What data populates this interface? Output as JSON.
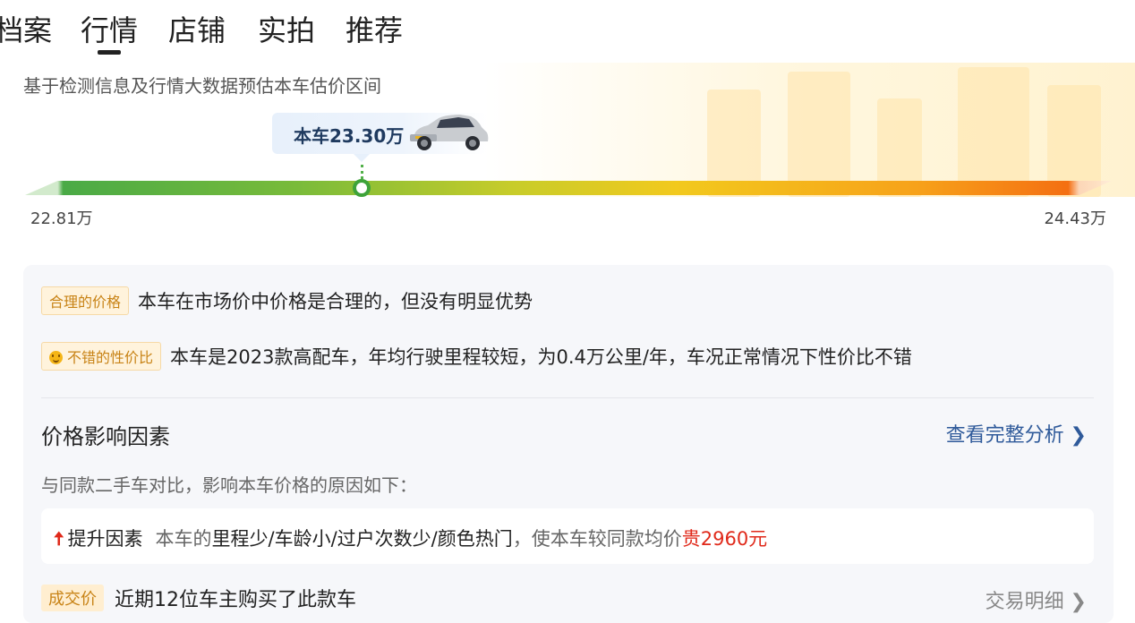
{
  "tabs": [
    {
      "label": "档案"
    },
    {
      "label": "行情"
    },
    {
      "label": "店铺"
    },
    {
      "label": "实拍"
    },
    {
      "label": "推荐"
    }
  ],
  "active_tab": "行情",
  "subtitle": "基于检测信息及行情大数据预估本车估价区间",
  "price_range": {
    "current_label": "本车23.30万",
    "current_value_wan": 23.3,
    "min_label": "22.81万",
    "max_label": "24.43万",
    "min_wan": 22.81,
    "max_wan": 24.43,
    "gradient_colors": [
      "#4aaa46",
      "#c8cc2a",
      "#f2c91d",
      "#f46f12"
    ]
  },
  "assessments": [
    {
      "badge": "合理的价格",
      "text": "本车在市场价中价格是合理的，但没有明显优势"
    },
    {
      "badge": "不错的性价比",
      "icon": "smile-icon",
      "text": "本车是2023款高配车，年均行驶里程较短，为0.4万公里/年，车况正常情况下性价比不错"
    }
  ],
  "factors": {
    "title": "价格影响因素",
    "link": "查看完整分析 ❯",
    "desc": "与同款二手车对比，影响本车价格的原因如下：",
    "items": [
      {
        "icon": "arrow-up-icon",
        "label": "提升因素",
        "prefix": "本车的",
        "emphasis": "里程少/车龄小/过户次数少/颜色热门",
        "middle": "，使本车较同款均价",
        "price": "贵2960元"
      }
    ]
  },
  "deal": {
    "badge": "成交价",
    "text": "近期12位车主购买了此款车",
    "link": "交易明细 ❯"
  },
  "colors": {
    "accent_red": "#e0291a",
    "link_blue": "#2f5a9a",
    "badge_orange": "#c88316"
  }
}
